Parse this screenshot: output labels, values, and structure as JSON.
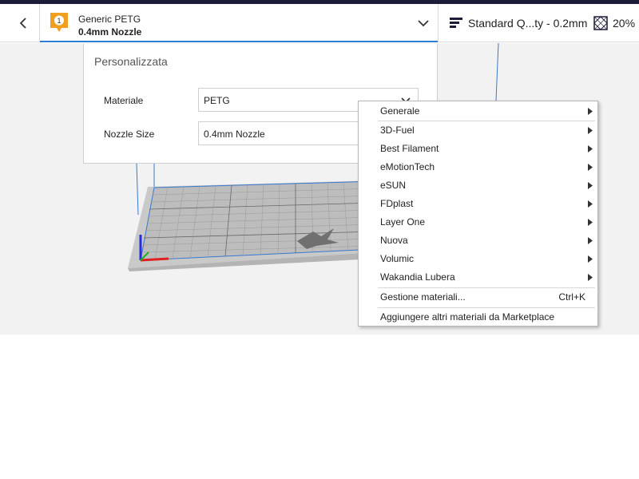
{
  "toolbar": {
    "extruder_number": "1",
    "material_name": "Generic PETG",
    "nozzle_name": "0.4mm Nozzle",
    "profile_label": "Standard Q...ty - 0.2mm",
    "infill_label": "20%",
    "accent_color": "#2c7ed6",
    "badge_color": "#f0a020"
  },
  "settings_panel": {
    "title": "Personalizzata",
    "material_label": "Materiale",
    "material_value": "PETG",
    "nozzle_label": "Nozzle Size",
    "nozzle_value": "0.4mm Nozzle"
  },
  "context_menu": {
    "items": [
      {
        "label": "Generale",
        "submenu": true
      },
      {
        "label": "3D-Fuel",
        "submenu": true
      },
      {
        "label": "Best Filament",
        "submenu": true
      },
      {
        "label": "eMotionTech",
        "submenu": true
      },
      {
        "label": "eSUN",
        "submenu": true
      },
      {
        "label": "FDplast",
        "submenu": true
      },
      {
        "label": "Layer One",
        "submenu": true
      },
      {
        "label": "Nuova",
        "submenu": true
      },
      {
        "label": "Volumic",
        "submenu": true
      },
      {
        "label": "Wakandia Lubera",
        "submenu": true
      }
    ],
    "manage_label": "Gestione materiali...",
    "manage_shortcut": "Ctrl+K",
    "marketplace_label": "Aggiungere altri materiali da Marketplace"
  }
}
